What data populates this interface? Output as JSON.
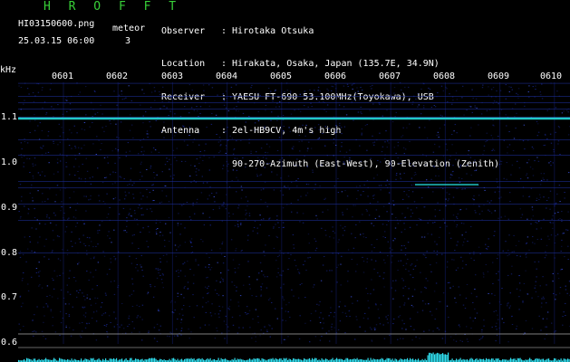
{
  "header": {
    "title": "H R O F F T",
    "filename": "HI03150600.png",
    "datetime": "25.03.15 06:00",
    "meteor_label": "meteor",
    "meteor_count": "3"
  },
  "info": [
    {
      "key": "Observer",
      "value": ": Hirotaka Otsuka"
    },
    {
      "key": "Location",
      "value": ": Hirakata, Osaka, Japan (135.7E, 34.9N)"
    },
    {
      "key": "Receiver",
      "value": ": YAESU FT-690 53.100MHz(Toyokawa), USB"
    },
    {
      "key": "Antenna",
      "value": ": 2el-HB9CV, 4m's high"
    },
    {
      "key": "",
      "value": "  90-270-Azimuth (East-West), 90-Elevation (Zenith)"
    }
  ],
  "axis": {
    "y_unit": "kHz",
    "x_ticks": [
      "0601",
      "0602",
      "0603",
      "0604",
      "0605",
      "0606",
      "0607",
      "0608",
      "0609",
      "0610"
    ],
    "y_ticks": [
      "1.1",
      "1.0",
      "0.9",
      "0.8",
      "0.7",
      "0.6"
    ],
    "y_values": [
      1.1,
      1.0,
      0.9,
      0.8,
      0.7,
      0.6
    ],
    "ylim": [
      0.59,
      1.15
    ]
  },
  "colors": {
    "background": "#000000",
    "noise": "#1a2a9a",
    "carrier": "#20c8c8",
    "text": "#ffffff",
    "title": "#38d038"
  }
}
